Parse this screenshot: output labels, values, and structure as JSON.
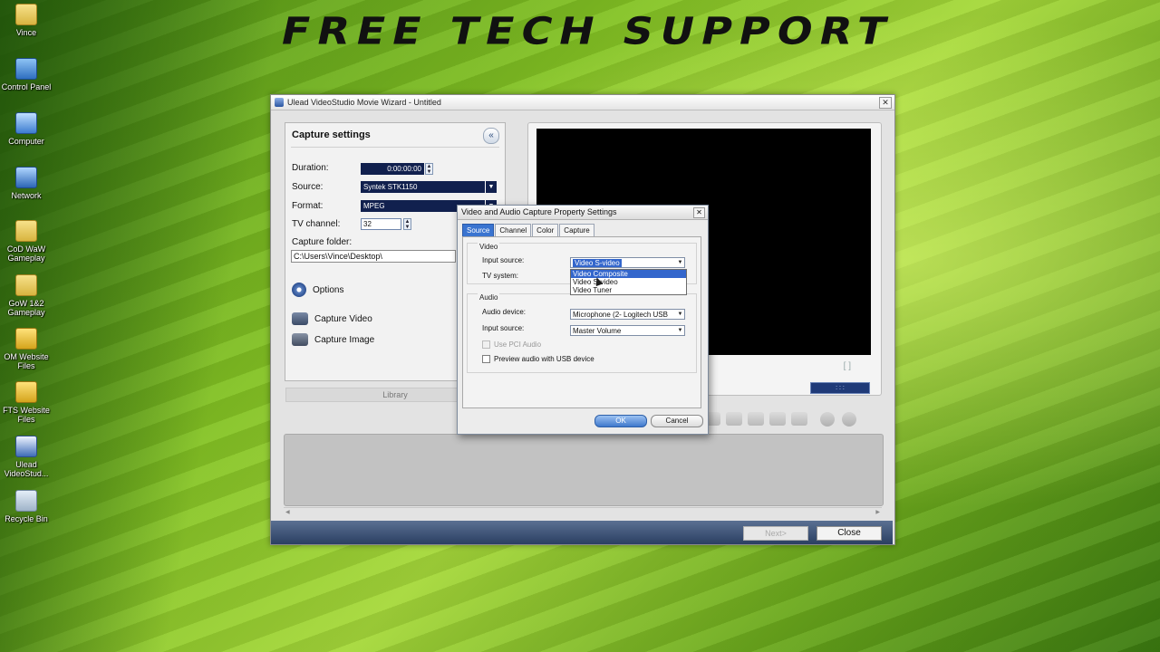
{
  "banner": "FREE TECH SUPPORT",
  "desktop": {
    "icons": [
      {
        "label": "Vince",
        "icon": "folder-icon"
      },
      {
        "label": "Control Panel",
        "icon": "control-panel-icon"
      },
      {
        "label": "Computer",
        "icon": "computer-icon"
      },
      {
        "label": "Network",
        "icon": "network-icon"
      },
      {
        "label": "CoD WaW Gameplay",
        "icon": "folder-icon"
      },
      {
        "label": "GoW 1&2 Gameplay",
        "icon": "folder-icon"
      },
      {
        "label": "OM Website Files",
        "icon": "lock-icon"
      },
      {
        "label": "FTS Website Files",
        "icon": "lock-icon"
      },
      {
        "label": "Ulead VideoStud...",
        "icon": "ulead-icon"
      },
      {
        "label": "Recycle Bin",
        "icon": "recycle-bin-icon"
      }
    ]
  },
  "window": {
    "title": "Ulead VideoStudio Movie Wizard - Untitled",
    "close": "✕"
  },
  "capture": {
    "title": "Capture settings",
    "collapse": "«",
    "duration_label": "Duration:",
    "duration_value": "0:00:00:00",
    "source_label": "Source:",
    "source_value": "Syntek STK1150",
    "format_label": "Format:",
    "format_value": "MPEG",
    "tv_label": "TV channel:",
    "tv_value": "32",
    "folder_label": "Capture folder:",
    "folder_value": "C:\\Users\\Vince\\Desktop\\",
    "options": "Options",
    "capture_video": "Capture Video",
    "capture_image": "Capture Image",
    "library": "Library"
  },
  "preview": {
    "brackets": "[ ]",
    "timecode": ":  :  :"
  },
  "footer": {
    "next": "Next>",
    "close": "Close"
  },
  "dialog": {
    "title": "Video and Audio Capture Property Settings",
    "close": "✕",
    "tabs": [
      "Source",
      "Channel",
      "Color",
      "Capture"
    ],
    "video_group": "Video",
    "input_source_label": "Input source:",
    "input_source_value": "Video S-video",
    "dropdown_options": [
      "Video Composite",
      "Video S-video",
      "Video Tuner"
    ],
    "tv_system_label": "TV system:",
    "audio_group": "Audio",
    "audio_device_label": "Audio device:",
    "audio_device_value": "Microphone (2- Logitech USB",
    "audio_input_label": "Input source:",
    "audio_input_value": "Master Volume",
    "use_pci_audio": "Use PCI Audio",
    "preview_audio": "Preview audio with USB device",
    "ok": "OK",
    "cancel": "Cancel"
  }
}
